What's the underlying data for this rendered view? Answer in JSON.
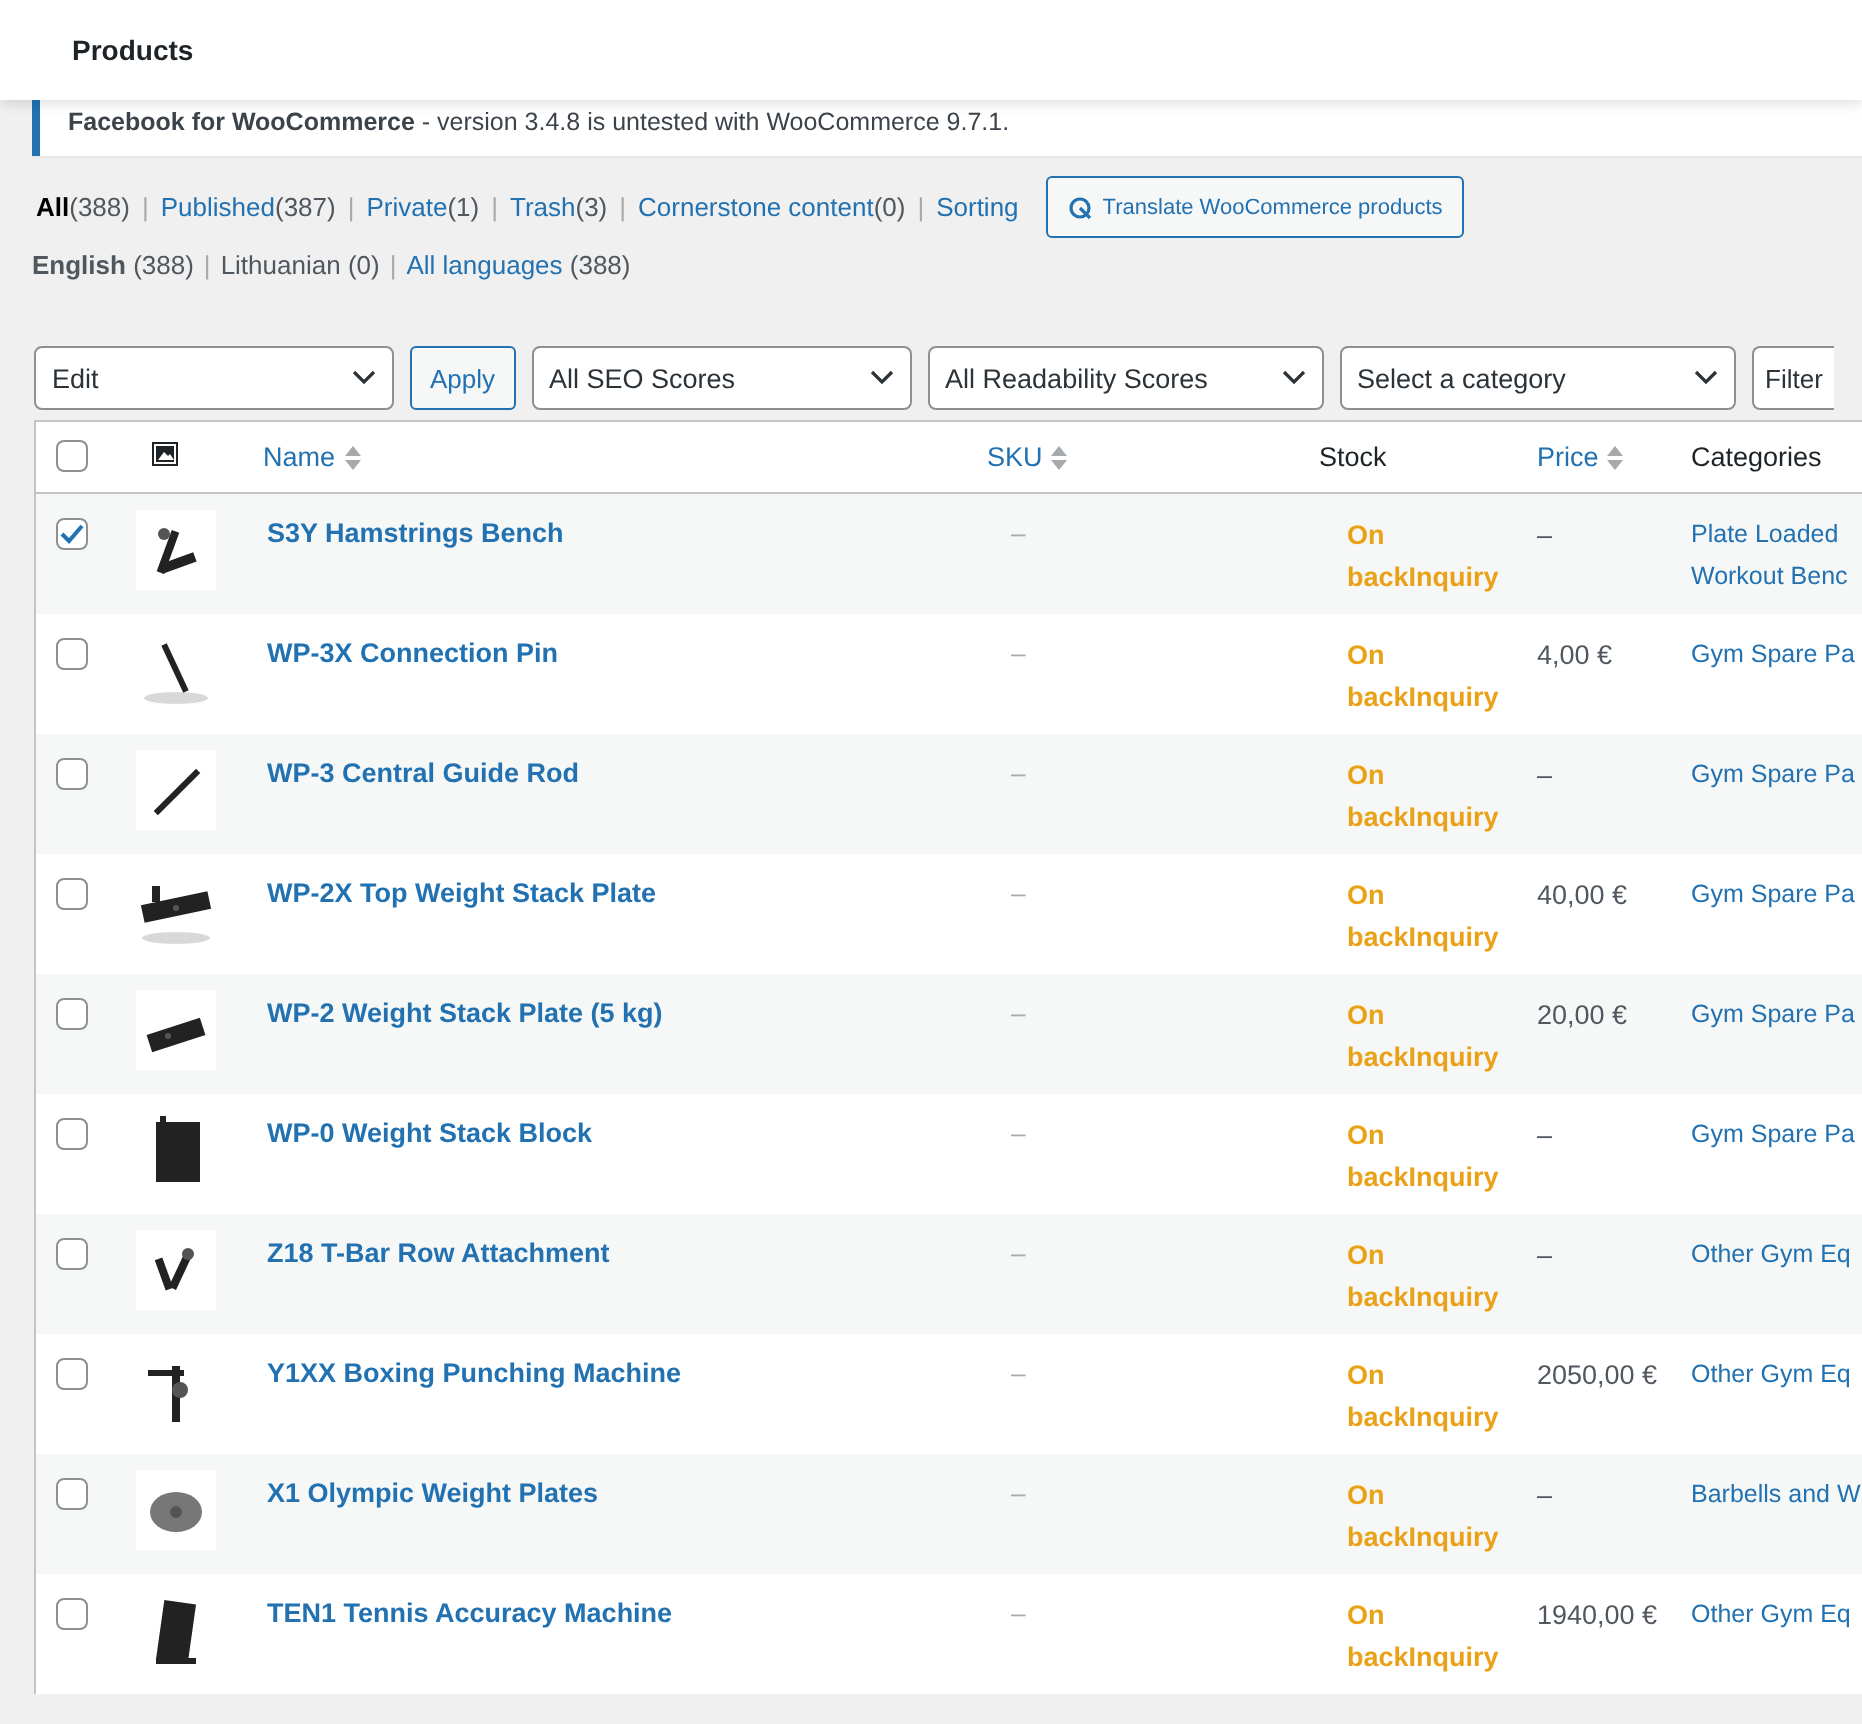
{
  "header": {
    "title": "Products"
  },
  "notice": {
    "text": "**Facebook for WooCommerce** - version 3.4.8 is untested with WooCommerce 9.7.1."
  },
  "views": [
    {
      "label": "All",
      "count": "(388)",
      "selected": true,
      "sep": "|"
    },
    {
      "label": "Published",
      "count": "(387)",
      "selected": false,
      "sep": "|"
    },
    {
      "label": "Private",
      "count": "(1)",
      "selected": false,
      "sep": "|"
    },
    {
      "label": "Trash",
      "count": "(3)",
      "selected": false,
      "sep": "|"
    },
    {
      "label": "Cornerstone content",
      "count": "(0)",
      "selected": false,
      "sep": "|"
    },
    {
      "label": "Sorting",
      "selected": false
    }
  ],
  "translate_button": "Translate WooCommerce products",
  "languages": [
    {
      "label": "English",
      "count": "(388)",
      "kind": "current",
      "sep": "|"
    },
    {
      "label": "Lithuanian",
      "count": "(0)",
      "kind": "plain",
      "sep": "|"
    },
    {
      "label": "All languages",
      "count": "(388)",
      "kind": "link"
    }
  ],
  "toolbar": {
    "bulk_action": "Edit",
    "apply": "Apply",
    "seo": "All SEO Scores",
    "readability": "All Readability Scores",
    "category": "Select a category",
    "filter": "Filter"
  },
  "table": {
    "select_all": false,
    "columns": [
      {
        "label": "Name",
        "sortable": true
      },
      {
        "label": "SKU",
        "sortable": true
      },
      {
        "label": "Stock",
        "sortable": false
      },
      {
        "label": "Price",
        "sortable": true
      },
      {
        "label": "Categories",
        "sortable": false
      }
    ],
    "rows": [
      {
        "checked": true,
        "name": "S3Y Hamstrings Bench",
        "sku": "–",
        "stock": "On backInquiry",
        "price": "–",
        "categories": [
          "Plate Loaded",
          "Workout Benc"
        ]
      },
      {
        "checked": false,
        "name": "WP-3X Connection Pin",
        "sku": "–",
        "stock": "On backInquiry",
        "price": "4,00 €",
        "categories": [
          "Gym Spare Pa"
        ]
      },
      {
        "checked": false,
        "name": "WP-3 Central Guide Rod",
        "sku": "–",
        "stock": "On backInquiry",
        "price": "–",
        "categories": [
          "Gym Spare Pa"
        ]
      },
      {
        "checked": false,
        "name": "WP-2X Top Weight Stack Plate",
        "sku": "–",
        "stock": "On backInquiry",
        "price": "40,00 €",
        "categories": [
          "Gym Spare Pa"
        ]
      },
      {
        "checked": false,
        "name": "WP-2 Weight Stack Plate (5 kg)",
        "sku": "–",
        "stock": "On backInquiry",
        "price": "20,00 €",
        "categories": [
          "Gym Spare Pa"
        ]
      },
      {
        "checked": false,
        "name": "WP-0 Weight Stack Block",
        "sku": "–",
        "stock": "On backInquiry",
        "price": "–",
        "categories": [
          "Gym Spare Pa"
        ]
      },
      {
        "checked": false,
        "name": "Z18 T-Bar Row Attachment",
        "sku": "–",
        "stock": "On backInquiry",
        "price": "–",
        "categories": [
          "Other Gym Eq"
        ]
      },
      {
        "checked": false,
        "name": "Y1XX Boxing Punching Machine",
        "sku": "–",
        "stock": "On backInquiry",
        "price": "2050,00 €",
        "categories": [
          "Other Gym Eq"
        ]
      },
      {
        "checked": false,
        "name": "X1 Olympic Weight Plates",
        "sku": "–",
        "stock": "On backInquiry",
        "price": "–",
        "categories": [
          "Barbells and W"
        ]
      },
      {
        "checked": false,
        "name": "TEN1 Tennis Accuracy Machine",
        "sku": "–",
        "stock": "On backInquiry",
        "price": "1940,00 €",
        "categories": [
          "Other Gym Eq"
        ]
      }
    ]
  }
}
